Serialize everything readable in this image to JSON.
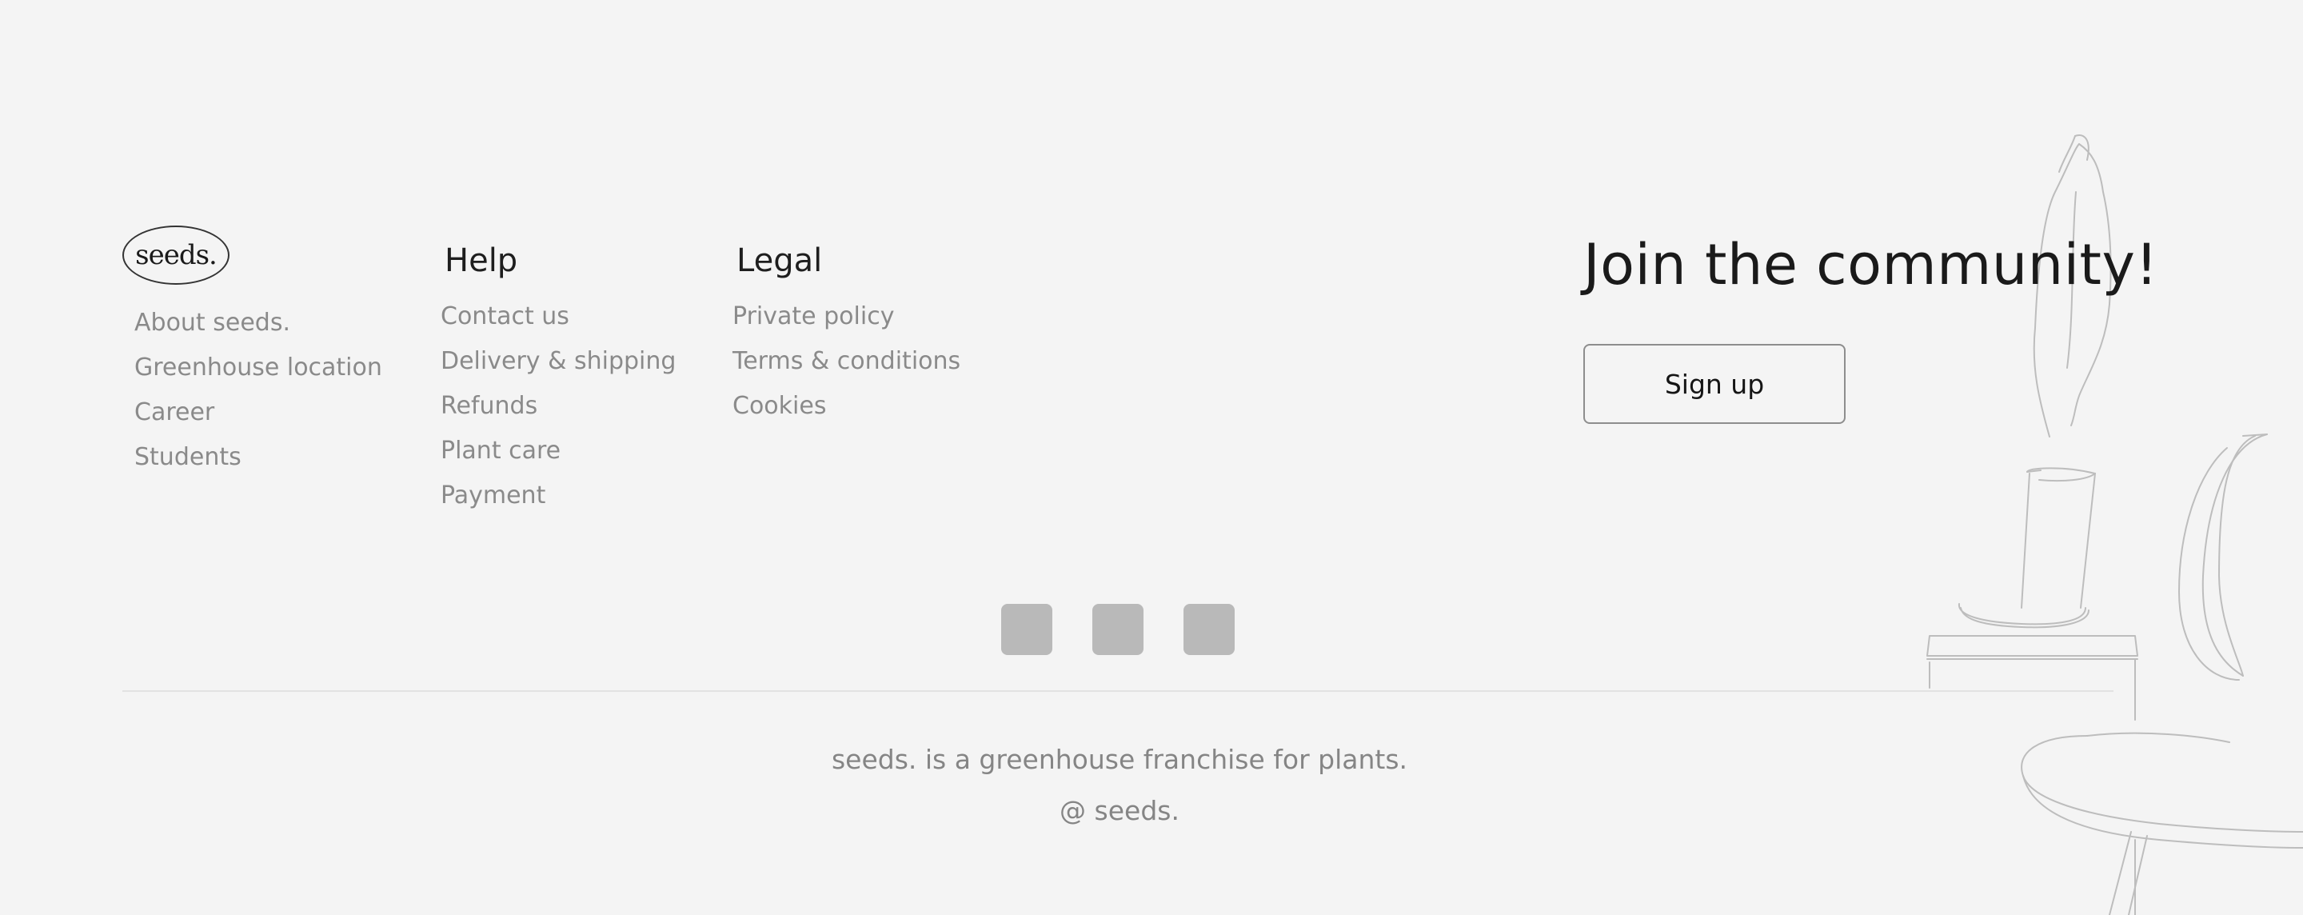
{
  "brand": {
    "logo_text": "seeds."
  },
  "columns": [
    {
      "title": "",
      "links": [
        "About seeds.",
        "Greenhouse location",
        "Career",
        "Students"
      ]
    },
    {
      "title": "Help",
      "links": [
        "Contact us",
        "Delivery & shipping",
        "Refunds",
        "Plant care",
        "Payment"
      ]
    },
    {
      "title": "Legal",
      "links": [
        "Private policy",
        "Terms & conditions",
        "Cookies"
      ]
    }
  ],
  "community": {
    "heading": "Join the community!",
    "signup_label": "Sign up"
  },
  "social": {
    "icons": [
      "social-icon-1",
      "social-icon-2",
      "social-icon-3"
    ],
    "icon_color": "#b9b9b9"
  },
  "bottom": {
    "tagline": "seeds. is a greenhouse franchise for plants.",
    "copyright": "@ seeds."
  },
  "colors": {
    "background": "#f4f4f4",
    "heading": "#1a1a1a",
    "muted_text": "#8a8a8a"
  }
}
